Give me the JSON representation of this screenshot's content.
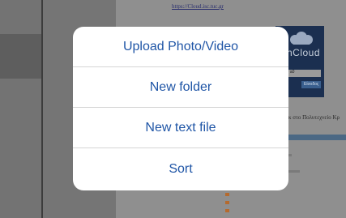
{
  "background": {
    "url": "https://Cloud.isc.tuc.gr",
    "login_title": "nCloud",
    "login_field": "ar a0",
    "login_button": "Είσοδος",
    "greek_text": "κ στο Πολυτεχνείο Κρ"
  },
  "menu": {
    "items": [
      {
        "label": "Upload Photo/Video"
      },
      {
        "label": "New folder"
      },
      {
        "label": "New text file"
      },
      {
        "label": "Sort"
      }
    ]
  },
  "colors": {
    "menu_text": "#1f55a6",
    "menu_background": "#ffffff",
    "separator": "#d6d6d6"
  }
}
